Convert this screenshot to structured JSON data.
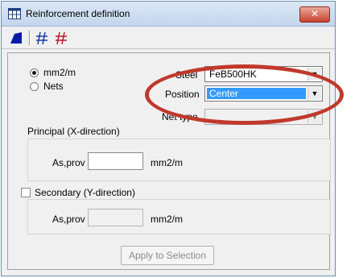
{
  "window": {
    "title": "Reinforcement definition",
    "close_label": "✕"
  },
  "units": {
    "mm2m_label": "mm2/m",
    "nets_label": "Nets",
    "selected": "mm2/m"
  },
  "steel": {
    "label": "Steel",
    "value": "FeB500HK"
  },
  "position": {
    "label": "Position",
    "value": "Center"
  },
  "net_type": {
    "label": "Net type",
    "value": ""
  },
  "principal": {
    "label": "Principal (X-direction)",
    "as_label": "As,prov",
    "value": "",
    "unit": "mm2/m"
  },
  "secondary": {
    "label": "Secondary (Y-direction)",
    "checked": false,
    "as_label": "As,prov",
    "value": "",
    "unit": "mm2/m"
  },
  "apply_label": "Apply to Selection",
  "annotation_color": "#c0392b"
}
